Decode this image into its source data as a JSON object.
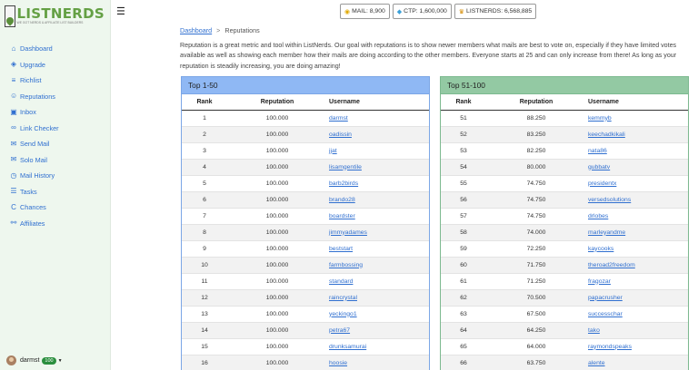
{
  "logo": {
    "title": "LISTNERDS",
    "tagline": "WE GOT NERDS & AFFILIATE LIST BUILDERS"
  },
  "nav": [
    {
      "label": "Dashboard",
      "icon": "home-icon"
    },
    {
      "label": "Upgrade",
      "icon": "layers-icon"
    },
    {
      "label": "Richlist",
      "icon": "list-icon"
    },
    {
      "label": "Reputations",
      "icon": "users-icon"
    },
    {
      "label": "Inbox",
      "icon": "inbox-icon"
    },
    {
      "label": "Link Checker",
      "icon": "link-icon"
    },
    {
      "label": "Send Mail",
      "icon": "envelope-icon"
    },
    {
      "label": "Solo Mail",
      "icon": "mail-open-icon"
    },
    {
      "label": "Mail History",
      "icon": "history-icon"
    },
    {
      "label": "Tasks",
      "icon": "tasks-icon"
    },
    {
      "label": "Chances",
      "icon": "chances-icon"
    },
    {
      "label": "Affiliates",
      "icon": "network-icon"
    }
  ],
  "user": {
    "name": "darmst",
    "badge": "100"
  },
  "stats": [
    {
      "label": "MAIL: 8,900",
      "icon": "coin-icon"
    },
    {
      "label": "CTP: 1,600,000",
      "icon": "diamond-icon"
    },
    {
      "label": "LISTNERDS: 6,568,885",
      "icon": "crown-icon"
    }
  ],
  "breadcrumb": {
    "home": "Dashboard",
    "sep": ">",
    "current": "Reputations"
  },
  "intro": "Reputation is a great metric and tool within ListNerds. Our goal with reputations is to show newer members what mails are best to vote on, especially if they have limited votes available as well as showing each member how their mails are doing according to the other members. Everyone starts at 25 and can only increase from there! As long as your reputation is steadily increasing, you are doing amazing!",
  "columns": {
    "rank": "Rank",
    "reputation": "Reputation",
    "username": "Username"
  },
  "panels": [
    {
      "title": "Top 1-50",
      "rows": [
        [
          "1",
          "100.000",
          "darmst"
        ],
        [
          "2",
          "100.000",
          "oadissin"
        ],
        [
          "3",
          "100.000",
          "jjat"
        ],
        [
          "4",
          "100.000",
          "lisamgentile"
        ],
        [
          "5",
          "100.000",
          "barb2birds"
        ],
        [
          "6",
          "100.000",
          "brando28"
        ],
        [
          "7",
          "100.000",
          "boardster"
        ],
        [
          "8",
          "100.000",
          "jimmyadames"
        ],
        [
          "9",
          "100.000",
          "beststart"
        ],
        [
          "10",
          "100.000",
          "farmbossing"
        ],
        [
          "11",
          "100.000",
          "standard"
        ],
        [
          "12",
          "100.000",
          "raincrystal"
        ],
        [
          "13",
          "100.000",
          "yeckingo1"
        ],
        [
          "14",
          "100.000",
          "petra67"
        ],
        [
          "15",
          "100.000",
          "drunksamurai"
        ],
        [
          "16",
          "100.000",
          "hoosie"
        ]
      ]
    },
    {
      "title": "Top 51-100",
      "rows": [
        [
          "51",
          "88.250",
          "kemmyb"
        ],
        [
          "52",
          "83.250",
          "keechadkikali"
        ],
        [
          "53",
          "82.250",
          "nata86"
        ],
        [
          "54",
          "80.000",
          "gubbatv"
        ],
        [
          "55",
          "74.750",
          "presidentx"
        ],
        [
          "56",
          "74.750",
          "versedsolutions"
        ],
        [
          "57",
          "74.750",
          "drlobes"
        ],
        [
          "58",
          "74.000",
          "marleyandme"
        ],
        [
          "59",
          "72.250",
          "kaycooks"
        ],
        [
          "60",
          "71.750",
          "theroad2freedom"
        ],
        [
          "61",
          "71.250",
          "fragozar"
        ],
        [
          "62",
          "70.500",
          "papacrusher"
        ],
        [
          "63",
          "67.500",
          "successchar"
        ],
        [
          "64",
          "64.250",
          "tako"
        ],
        [
          "65",
          "64.000",
          "raymondspeaks"
        ],
        [
          "66",
          "63.750",
          "alente"
        ]
      ]
    }
  ]
}
